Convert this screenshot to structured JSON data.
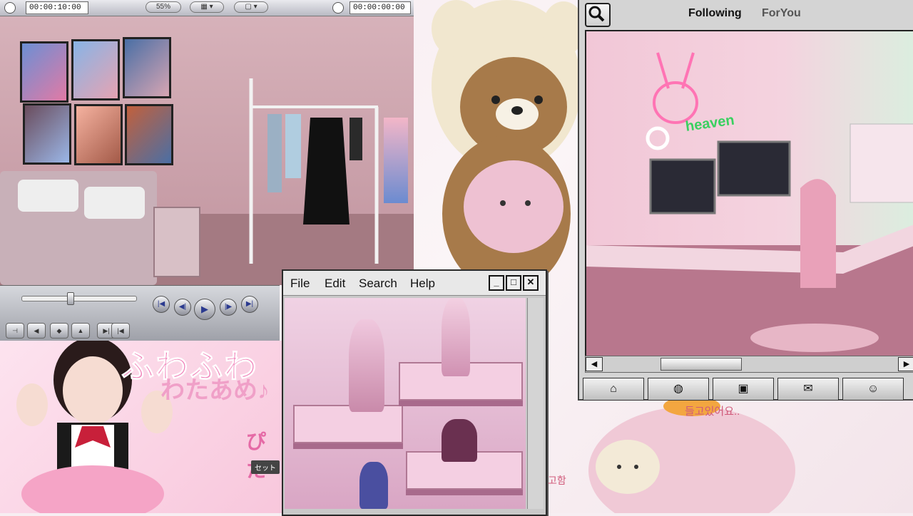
{
  "player": {
    "timecode_left": "00:00:10:00",
    "zoom": "55%",
    "timecode_right": "00:00:00:00"
  },
  "retro_window": {
    "menu": [
      "File",
      "Edit",
      "Search",
      "Help"
    ],
    "controls": {
      "minimize": "_",
      "maximize": "□",
      "close": "✕"
    }
  },
  "social_window": {
    "tabs": {
      "following": "Following",
      "for_you": "ForYou"
    },
    "neon_sign": "heaven",
    "nav_icons": [
      "home-icon",
      "globe-icon",
      "camera-icon",
      "mail-icon",
      "profile-icon"
    ]
  },
  "promo": {
    "title_line1": "ふわふわ",
    "title_line2": "わたあめ♪",
    "title_line3": "ぴた",
    "tag": "セット"
  },
  "captions": {
    "korean_right": "들고있어요..",
    "korean_left": "고함"
  },
  "colors": {
    "accent_pink": "#f07fb8",
    "neon_green": "#3ad060",
    "chrome_gray": "#d4d4d4"
  }
}
